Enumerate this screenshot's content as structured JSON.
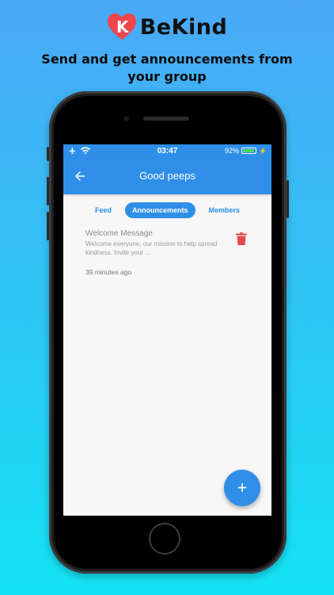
{
  "brand": {
    "name": "BeKind",
    "logo_letter": "K",
    "heart_color": "#f0454b"
  },
  "tagline": "Send and get announcements from your group",
  "status_bar": {
    "time": "03:47",
    "battery": "92%"
  },
  "app_bar": {
    "title": "Good peeps",
    "back_icon": "arrow-left-icon"
  },
  "tabs": [
    {
      "label": "Feed",
      "active": false
    },
    {
      "label": "Announcements",
      "active": true
    },
    {
      "label": "Members",
      "active": false
    }
  ],
  "announcements": [
    {
      "title": "Welcome Message",
      "body": "Welcome everyone, our mission to help spread kindness. Invite your ...",
      "time": "39 minutes ago",
      "delete_icon": "trash-icon"
    }
  ],
  "fab": {
    "label": "+",
    "icon": "plus-icon"
  },
  "colors": {
    "accent": "#2f8fe8",
    "danger": "#e5484d"
  }
}
